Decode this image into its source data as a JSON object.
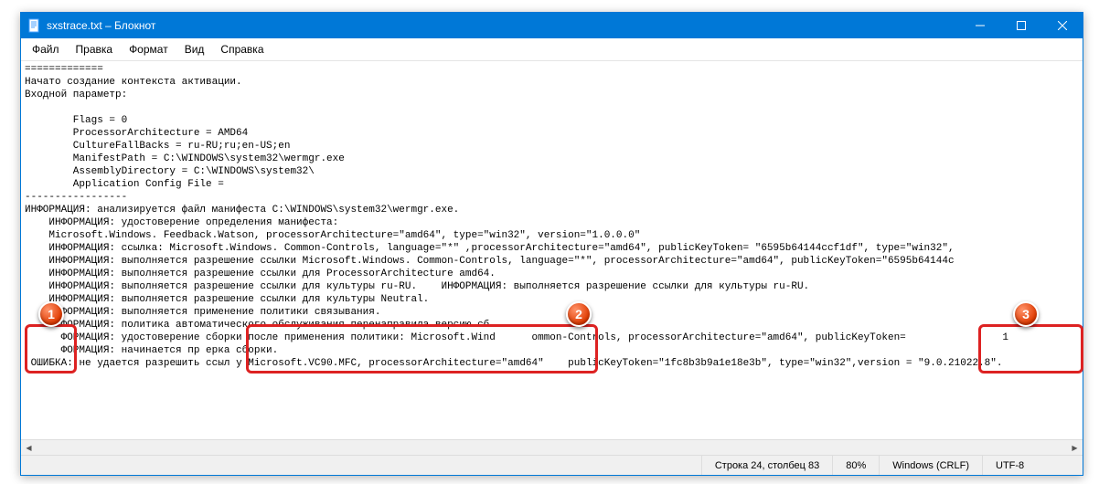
{
  "window": {
    "title": "sxstrace.txt – Блокнот"
  },
  "menu": {
    "file": "Файл",
    "edit": "Правка",
    "format": "Формат",
    "view": "Вид",
    "help": "Справка"
  },
  "content": {
    "line01": "=============",
    "line02": "Начато создание контекста активации.",
    "line03": "Входной параметр:",
    "line04": "",
    "line05": "        Flags = 0",
    "line06": "        ProcessorArchitecture = AMD64",
    "line07": "        CultureFallBacks = ru-RU;ru;en-US;en",
    "line08": "        ManifestPath = C:\\WINDOWS\\system32\\wermgr.exe",
    "line09": "        AssemblyDirectory = C:\\WINDOWS\\system32\\",
    "line10": "        Application Config File =",
    "line11": "-----------------",
    "line12": "ИНФОРМАЦИЯ: анализируется файл манифеста C:\\WINDOWS\\system32\\wermgr.exe.",
    "line13": "    ИНФОРМАЦИЯ: удостоверение определения манифеста:",
    "line14": "    Microsoft.Windows. Feedback.Watson, processorArchitecture=\"amd64\", type=\"win32\", version=\"1.0.0.0\"",
    "line15": "    ИНФОРМАЦИЯ: ссылка: Microsoft.Windows. Common-Controls, language=\"*\" ,processorArchitecture=\"amd64\", publicKeyToken= \"6595b64144ccf1df\", type=\"win32\",",
    "line16": "    ИНФОРМАЦИЯ: выполняется разрешение ссылки Microsoft.Windows. Common-Controls, language=\"*\", processorArchitecture=\"amd64\", publicKeyToken=\"6595b64144c",
    "line17": "    ИНФОРМАЦИЯ: выполняется разрешение ссылки для ProcessorArchitecture amd64.",
    "line18": "    ИНФОРМАЦИЯ: выполняется разрешение ссылки для культуры ru-RU.    ИНФОРМАЦИЯ: выполняется разрешение ссылки для культуры ru-RU.",
    "line19": "    ИНФОРМАЦИЯ: выполняется разрешение ссылки для культуры Neutral.",
    "line20": "    ИНФОРМАЦИЯ: выполняется применение политики связывания.",
    "line21_a": "    ",
    "line21_b": "ФОРМАЦИЯ: политика автоматического обслуживания перенаправила версию сб",
    "line22_a": "    ",
    "line22_b": "ФОРМАЦИЯ: удостоверение сборки после применения политики: Microsoft.Wind",
    "line22_c": "ommon-Controls, processorArchitecture=\"amd64\", publicKeyToken=",
    "line22_d": "1",
    "line23_a": "",
    "line23_b": "ФОРМАЦИЯ: начинается пр",
    "line23_c": "ерка сборки.",
    "line24_a": "ОШИБКА:",
    "line24_b": "не удается разрешить ссыл",
    "line24_c": "у Microsoft.VC90.MFC, processorArchitecture=\"amd64\"",
    "line24_d": " publicKeyToken=\"1fc8b3b9a1e18e3b\", type=\"win32\",version",
    "line24_e": "= \"9.0.21022.8\".",
    "line25": ""
  },
  "statusbar": {
    "position": "Строка 24, столбец 83",
    "zoom": "80%",
    "eol": "Windows (CRLF)",
    "encoding": "UTF-8"
  },
  "markers": {
    "m1": "1",
    "m2": "2",
    "m3": "3"
  }
}
